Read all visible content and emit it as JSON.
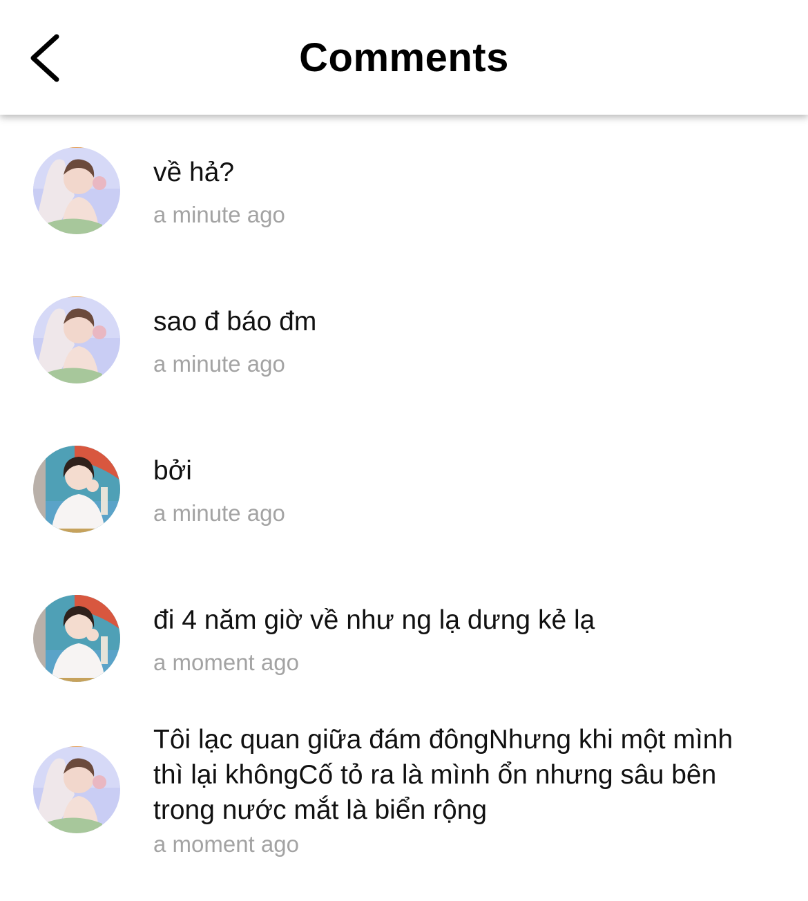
{
  "header": {
    "title": "Comments",
    "back_icon": "chevron-left-icon"
  },
  "comments": [
    {
      "avatar": "avatar-a",
      "text": "về hả?",
      "time": "a minute ago"
    },
    {
      "avatar": "avatar-a",
      "text": "sao đ báo đm",
      "time": "a minute ago"
    },
    {
      "avatar": "avatar-b",
      "text": "bởi",
      "time": "a minute ago"
    },
    {
      "avatar": "avatar-b",
      "text": "đi 4 năm giờ về như ng lạ dưng kẻ lạ",
      "time": "a moment ago"
    },
    {
      "avatar": "avatar-a",
      "text": "Tôi lạc quan giữa đám đôngNhưng khi một mình thì lại khôngCố tỏ ra là mình ổn nhưng sâu bên trong nước mắt là biển rộng",
      "time": "a moment ago"
    }
  ]
}
